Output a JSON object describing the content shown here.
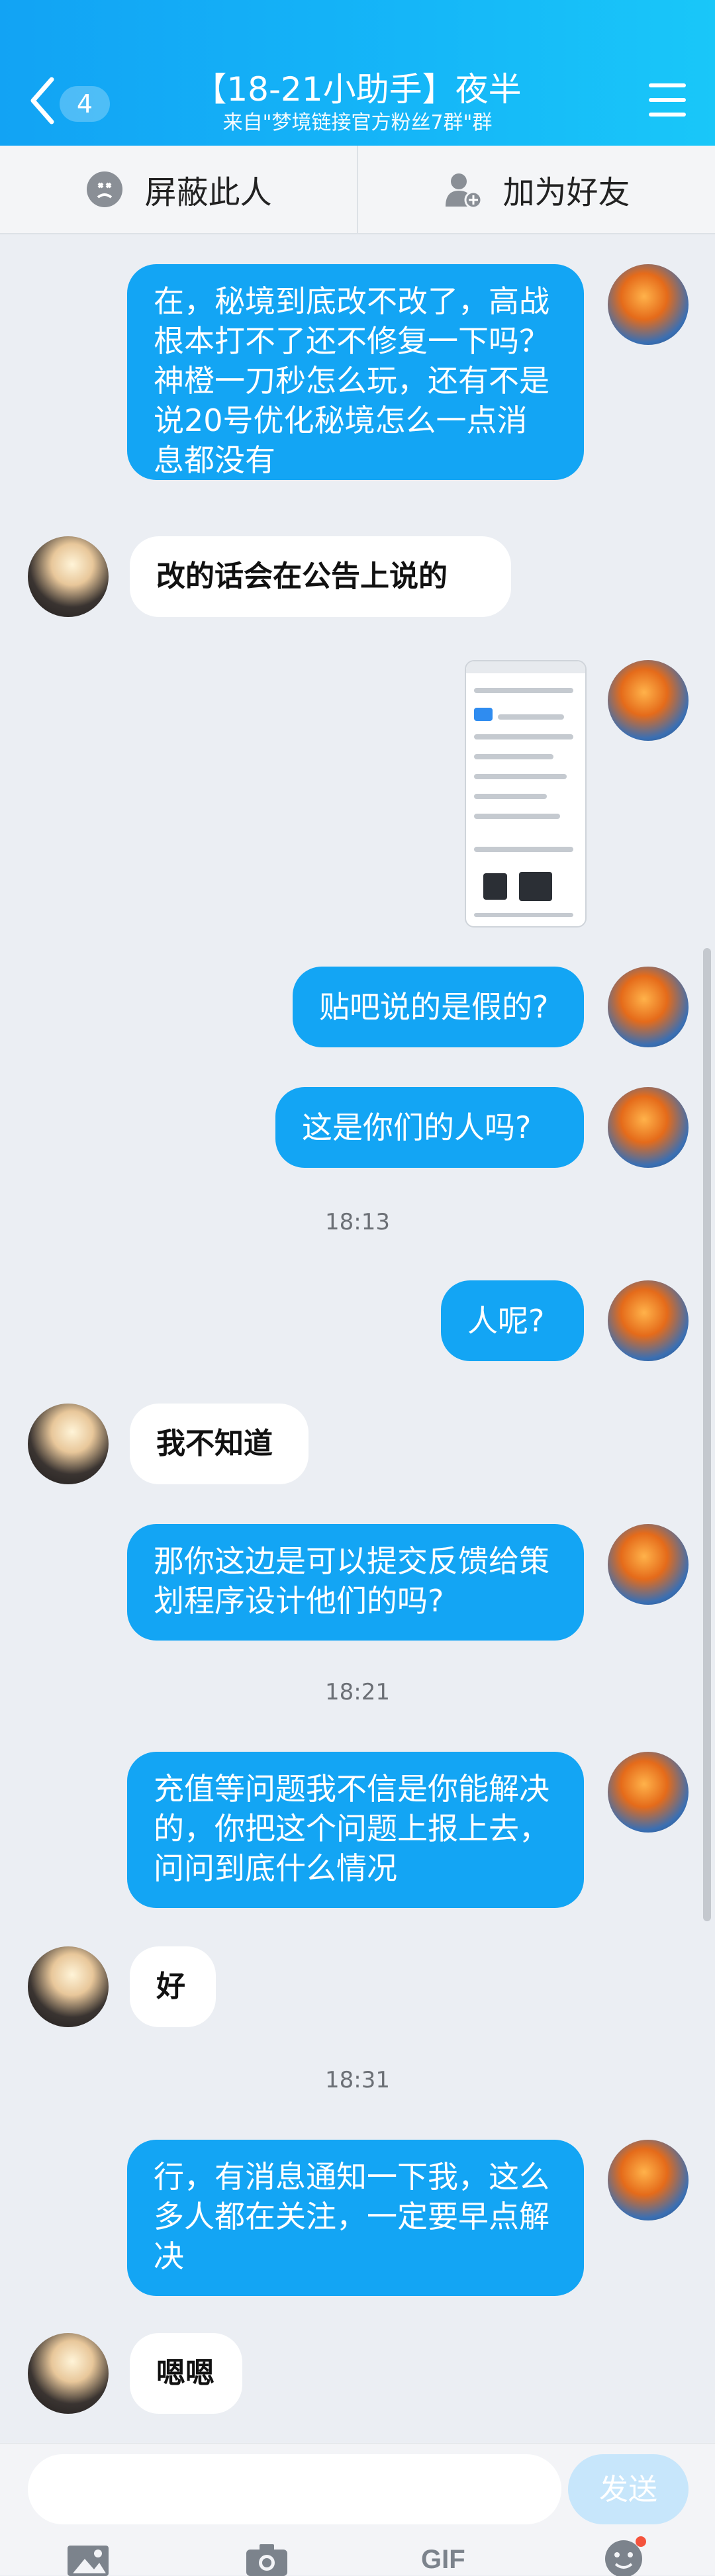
{
  "header": {
    "badge": "4",
    "title": "【18-21小助手】夜半",
    "subtitle": "来自\"梦境链接官方粉丝7群\"群"
  },
  "actions": {
    "block": "屏蔽此人",
    "add_friend": "加为好友"
  },
  "messages": [
    {
      "sender": "me",
      "text": "在，秘境到底改不改了，高战根本打不了还不修复一下吗？神橙一刀秒怎么玩，还有不是说20号优化秘境怎么一点消息都没有"
    },
    {
      "sender": "other",
      "text": "改的话会在公告上说的"
    },
    {
      "sender": "me",
      "type": "image"
    },
    {
      "sender": "me",
      "text": "贴吧说的是假的?"
    },
    {
      "sender": "me",
      "text": "这是你们的人吗?"
    },
    {
      "type": "time",
      "text": "18:13"
    },
    {
      "sender": "me",
      "text": "人呢?"
    },
    {
      "sender": "other",
      "text": "我不知道"
    },
    {
      "sender": "me",
      "text": "那你这边是可以提交反馈给策划程序设计他们的吗?"
    },
    {
      "type": "time",
      "text": "18:21"
    },
    {
      "sender": "me",
      "text": "充值等问题我不信是你能解决的，你把这个问题上报上去，问问到底什么情况"
    },
    {
      "sender": "other",
      "text": "好"
    },
    {
      "type": "time",
      "text": "18:31"
    },
    {
      "sender": "me",
      "text": "行，有消息通知一下我，这么多人都在关注，一定要早点解决"
    },
    {
      "sender": "other",
      "text": "嗯嗯"
    }
  ],
  "input": {
    "value": "",
    "send_label": "发送"
  },
  "toolbar": {
    "gif_label": "GIF",
    "icons": [
      "image-icon",
      "camera-icon",
      "gif-icon",
      "emoji-icon"
    ]
  },
  "colors": {
    "accent": "#13a5f4",
    "header": "#15b7f8",
    "background": "#ebeef3"
  }
}
